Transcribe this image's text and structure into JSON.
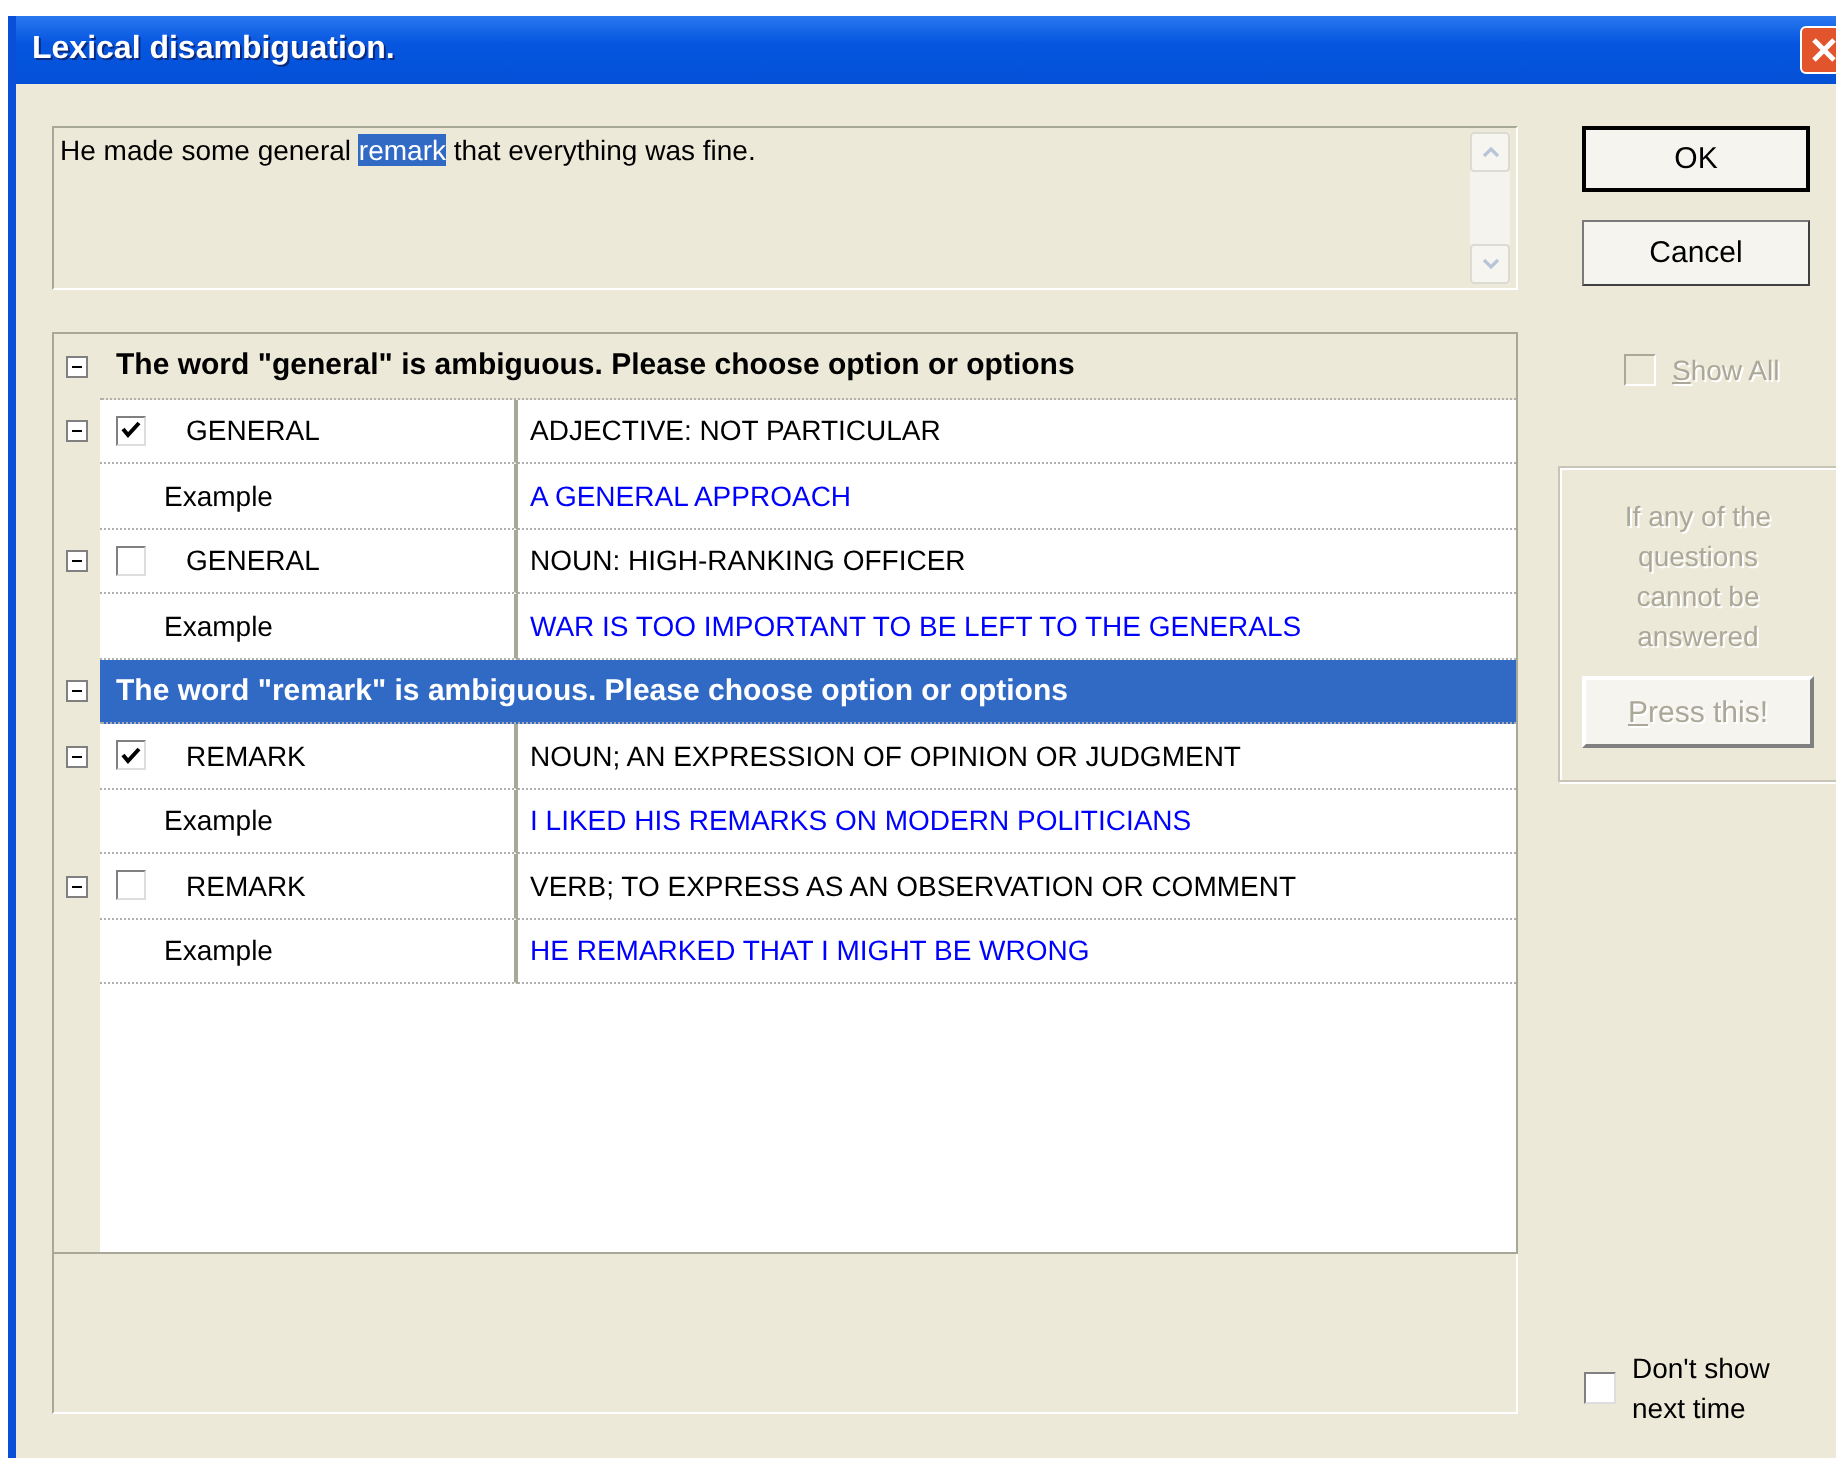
{
  "window": {
    "title": "Lexical disambiguation."
  },
  "sentence": [
    {
      "text": "He made some general ",
      "selected": false
    },
    {
      "text": "remark",
      "selected": true
    },
    {
      "text": " that everything was fine.",
      "selected": false
    }
  ],
  "buttons": {
    "ok": "OK",
    "cancel": "Cancel"
  },
  "groups": [
    {
      "header": "The word \"general\" is ambiguous. Please choose option or options",
      "selected": false,
      "expanded": true,
      "options": [
        {
          "word": "GENERAL",
          "meaning": "ADJECTIVE: NOT PARTICULAR",
          "checked": true,
          "expanded": true,
          "example_label": "Example",
          "example": "A GENERAL APPROACH"
        },
        {
          "word": "GENERAL",
          "meaning": "NOUN: HIGH-RANKING OFFICER",
          "checked": false,
          "expanded": true,
          "example_label": "Example",
          "example": "WAR IS TOO IMPORTANT TO BE LEFT TO THE GENERALS"
        }
      ]
    },
    {
      "header": "The word \"remark\" is ambiguous. Please choose option or options",
      "selected": true,
      "expanded": true,
      "options": [
        {
          "word": "REMARK",
          "meaning": "NOUN; AN EXPRESSION OF OPINION OR JUDGMENT",
          "checked": true,
          "expanded": true,
          "example_label": "Example",
          "example": "I LIKED HIS REMARKS ON MODERN POLITICIANS"
        },
        {
          "word": "REMARK",
          "meaning": "VERB; TO EXPRESS AS AN OBSERVATION OR COMMENT",
          "checked": false,
          "expanded": true,
          "example_label": "Example",
          "example": "HE REMARKED THAT I MIGHT BE WRONG"
        }
      ]
    }
  ],
  "show_all": {
    "label": "Show All",
    "checked": false,
    "disabled": true
  },
  "help_panel": {
    "text": "If any of the questions cannot be answered",
    "button": "Press this!",
    "disabled": true
  },
  "dont_show": {
    "label": "Don't show next time",
    "checked": false
  }
}
